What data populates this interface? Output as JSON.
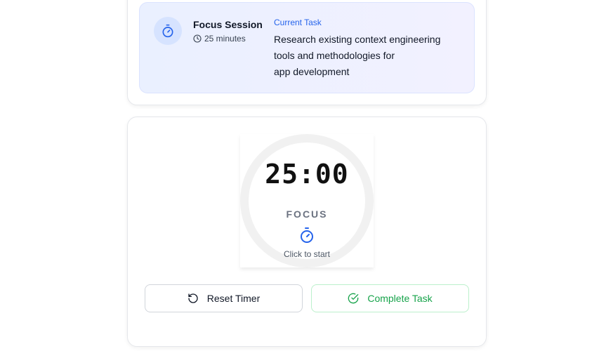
{
  "session": {
    "title": "Focus Session",
    "duration": "25 minutes",
    "task_label": "Current Task",
    "task_lines": [
      "Research existing context engineering",
      "tools and methodologies for",
      "app development"
    ],
    "icon": "stopwatch-icon"
  },
  "timer": {
    "time": "25:00",
    "mode": "FOCUS",
    "hint": "Click to start",
    "icon": "stopwatch-icon"
  },
  "actions": {
    "reset_label": "Reset Timer",
    "reset_icon": "rotate-ccw-icon",
    "complete_label": "Complete Task",
    "complete_icon": "check-circle-icon"
  },
  "colors": {
    "accent_blue": "#2563eb",
    "success_green": "#16a34a",
    "banner_bg": "#eaf0ff"
  }
}
